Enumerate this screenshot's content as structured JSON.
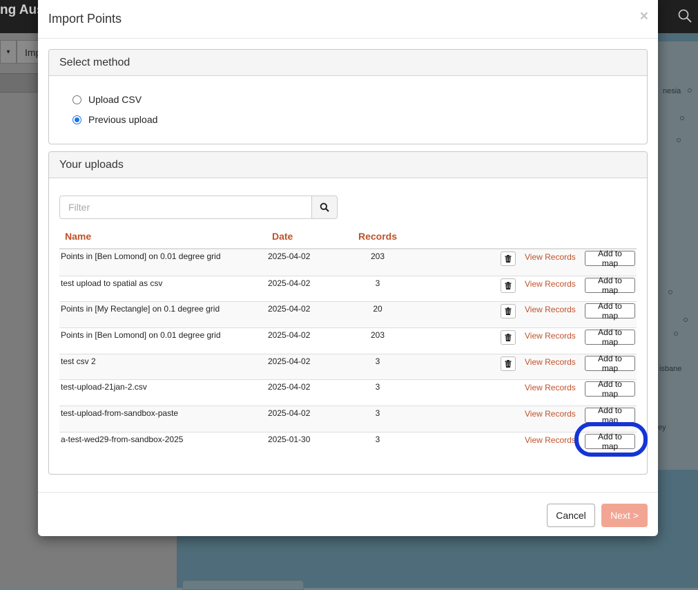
{
  "background": {
    "app_title": "ng Aus",
    "toolbar_dropdown_glyph": "▾",
    "toolbar_button_label": "Imp",
    "map_labels": [
      "nesia",
      "isbane",
      "ey"
    ]
  },
  "modal": {
    "title": "Import Points",
    "close_label": "×",
    "method_panel": {
      "heading": "Select method",
      "options": [
        {
          "label": "Upload CSV",
          "checked": false
        },
        {
          "label": "Previous upload",
          "checked": true
        }
      ]
    },
    "uploads_panel": {
      "heading": "Your uploads",
      "filter_placeholder": "Filter",
      "filter_value": "",
      "columns": {
        "name": "Name",
        "date": "Date",
        "records": "Records"
      },
      "rows": [
        {
          "name": "Points in [Ben Lomond] on 0.01 degree grid",
          "date": "2025-04-02",
          "records": "203",
          "deletable": true,
          "view_label": "View Records",
          "add_label": "Add to map"
        },
        {
          "name": "test upload to spatial as csv",
          "date": "2025-04-02",
          "records": "3",
          "deletable": true,
          "view_label": "View Records",
          "add_label": "Add to map"
        },
        {
          "name": "Points in [My Rectangle] on 0.1 degree grid",
          "date": "2025-04-02",
          "records": "20",
          "deletable": true,
          "view_label": "View Records",
          "add_label": "Add to map"
        },
        {
          "name": "Points in [Ben Lomond] on 0.01 degree grid",
          "date": "2025-04-02",
          "records": "203",
          "deletable": true,
          "view_label": "View Records",
          "add_label": "Add to map"
        },
        {
          "name": "test csv 2",
          "date": "2025-04-02",
          "records": "3",
          "deletable": true,
          "view_label": "View Records",
          "add_label": "Add to map"
        },
        {
          "name": "test-upload-21jan-2.csv",
          "date": "2025-04-02",
          "records": "3",
          "deletable": false,
          "view_label": "View Records",
          "add_label": "Add to map"
        },
        {
          "name": "test-upload-from-sandbox-paste",
          "date": "2025-04-02",
          "records": "3",
          "deletable": false,
          "view_label": "View Records",
          "add_label": "Add to map"
        },
        {
          "name": "a-test-wed29-from-sandbox-2025",
          "date": "2025-01-30",
          "records": "3",
          "deletable": false,
          "view_label": "View Records",
          "add_label": "Add to map"
        }
      ]
    },
    "footer": {
      "cancel_label": "Cancel",
      "next_label": "Next >"
    }
  },
  "colors": {
    "accent_link": "#c0512a",
    "next_disabled": "#f3a594",
    "highlight_ring": "#1535d6"
  }
}
